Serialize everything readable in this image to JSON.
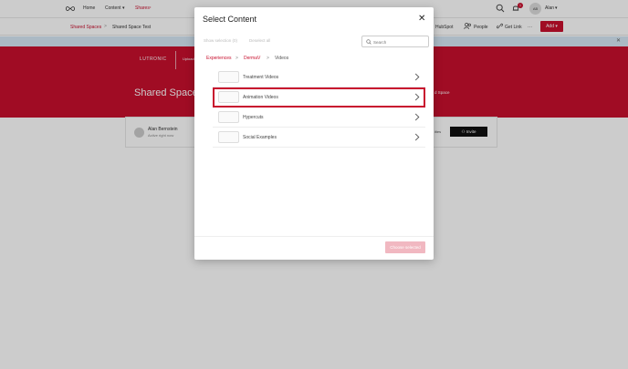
{
  "nav": {
    "links": [
      "Home",
      "Content",
      "Shares"
    ],
    "content_caret": "▾",
    "shares_marker": "•",
    "notification_count": "1",
    "avatar_initials": "AB",
    "user_name": "Alan",
    "user_caret": "▾"
  },
  "subbar": {
    "breadcrumb": [
      "Shared Spaces",
      "Shared Space Test"
    ],
    "breadcrumb_sep": ">",
    "actions": [
      "HubSpot",
      "People",
      "Get Link",
      "···"
    ],
    "add_label": "Add ▾"
  },
  "hero": {
    "brand": "LUTRONIC",
    "upload_text": "Upload",
    "title": "Shared Space",
    "title_right": "d Space"
  },
  "author": {
    "name": "Alan Bernstein",
    "status": "Active right now",
    "tail_text": "ities",
    "invite_label": "Invite"
  },
  "modal": {
    "title": "Select Content",
    "close": "✕",
    "selection_links": [
      "Show selection (0)",
      "Deselect all"
    ],
    "search_placeholder": "Search",
    "breadcrumb": [
      "Experiences",
      "DermaV",
      "Videos"
    ],
    "breadcrumb_sep": ">",
    "items": [
      {
        "label": "Treatment Videos",
        "highlighted": false
      },
      {
        "label": "Animation Videos",
        "highlighted": true
      },
      {
        "label": "Hypercuts",
        "highlighted": false
      },
      {
        "label": "Social Examples",
        "highlighted": false
      }
    ],
    "choose_label": "Choose selected"
  },
  "colors": {
    "brand": "#c8102e",
    "overlay": "rgba(0,0,0,0.2)"
  }
}
